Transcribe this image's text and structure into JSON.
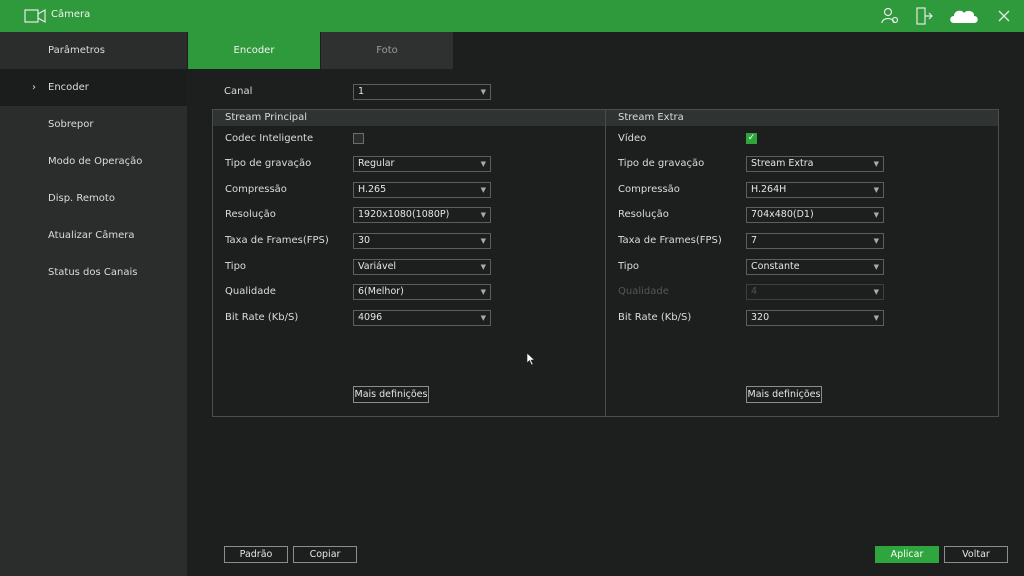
{
  "window": {
    "title": "Câmera"
  },
  "sidebar": {
    "items": [
      {
        "label": "Parâmetros"
      },
      {
        "label": "Encoder",
        "active": true
      },
      {
        "label": "Sobrepor"
      },
      {
        "label": "Modo de Operação"
      },
      {
        "label": "Disp. Remoto"
      },
      {
        "label": "Atualizar Câmera"
      },
      {
        "label": "Status dos Canais"
      }
    ]
  },
  "tabs": [
    {
      "label": "Encoder",
      "active": true
    },
    {
      "label": "Foto"
    }
  ],
  "canal": {
    "label": "Canal",
    "value": "1"
  },
  "main_stream": {
    "title": "Stream Principal",
    "codec": {
      "label": "Codec Inteligente",
      "checked": false
    },
    "rec_type": {
      "label": "Tipo de gravação",
      "value": "Regular"
    },
    "compression": {
      "label": "Compressão",
      "value": "H.265"
    },
    "resolution": {
      "label": "Resolução",
      "value": "1920x1080(1080P)"
    },
    "fps": {
      "label": "Taxa de Frames(FPS)",
      "value": "30"
    },
    "type": {
      "label": "Tipo",
      "value": "Variável"
    },
    "quality": {
      "label": "Qualidade",
      "value": "6(Melhor)"
    },
    "bitrate": {
      "label": "Bit Rate (Kb/S)",
      "value": "4096"
    },
    "more": "Mais definições"
  },
  "extra_stream": {
    "title": "Stream Extra",
    "video": {
      "label": "Vídeo",
      "checked": true
    },
    "rec_type": {
      "label": "Tipo de gravação",
      "value": "Stream Extra"
    },
    "compression": {
      "label": "Compressão",
      "value": "H.264H"
    },
    "resolution": {
      "label": "Resolução",
      "value": "704x480(D1)"
    },
    "fps": {
      "label": "Taxa de Frames(FPS)",
      "value": "7"
    },
    "type": {
      "label": "Tipo",
      "value": "Constante"
    },
    "quality": {
      "label": "Qualidade",
      "value": "4"
    },
    "bitrate": {
      "label": "Bit Rate (Kb/S)",
      "value": "320"
    },
    "more": "Mais definições"
  },
  "footer": {
    "default": "Padrão",
    "copy": "Copiar",
    "apply": "Aplicar",
    "back": "Voltar"
  },
  "colors": {
    "accent": "#2f9a3b",
    "background": "#1c1f1d",
    "sidebar": "#2a2d2b"
  },
  "icons": [
    "camera-icon",
    "user-settings-icon",
    "export-icon",
    "cloud-icon",
    "close-icon",
    "chevron-right-icon",
    "chevron-down-icon",
    "check-icon",
    "mouse-cursor-icon"
  ]
}
